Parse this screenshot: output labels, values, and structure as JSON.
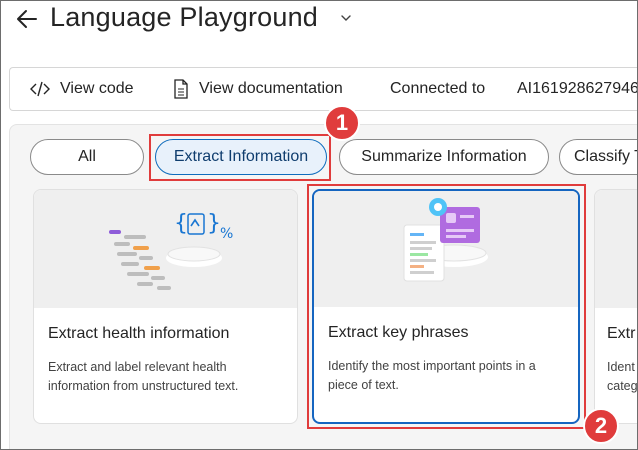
{
  "header": {
    "title": "Language Playground"
  },
  "toolbar": {
    "view_code": "View code",
    "view_documentation": "View documentation",
    "connected_to": "Connected to",
    "resource_name": "AI161928627946"
  },
  "filters": {
    "all": "All",
    "extract": "Extract Information",
    "summarize": "Summarize Information",
    "classify": "Classify T"
  },
  "cards": [
    {
      "title": "Extract health information",
      "desc_line1": "Extract and label relevant health",
      "desc_line2": "information from unstructured text."
    },
    {
      "title": "Extract key phrases",
      "desc_line1": "Identify the most important points in a",
      "desc_line2": "piece of text."
    },
    {
      "title": "Extr",
      "desc_line1": "Ident",
      "desc_line2": "categ"
    }
  ],
  "annotations": {
    "badge1": "1",
    "badge2": "2"
  },
  "colors": {
    "annotation": "#e03c3c",
    "selected_border": "#1565c0",
    "selected_pill_bg": "#e8f1fb"
  }
}
